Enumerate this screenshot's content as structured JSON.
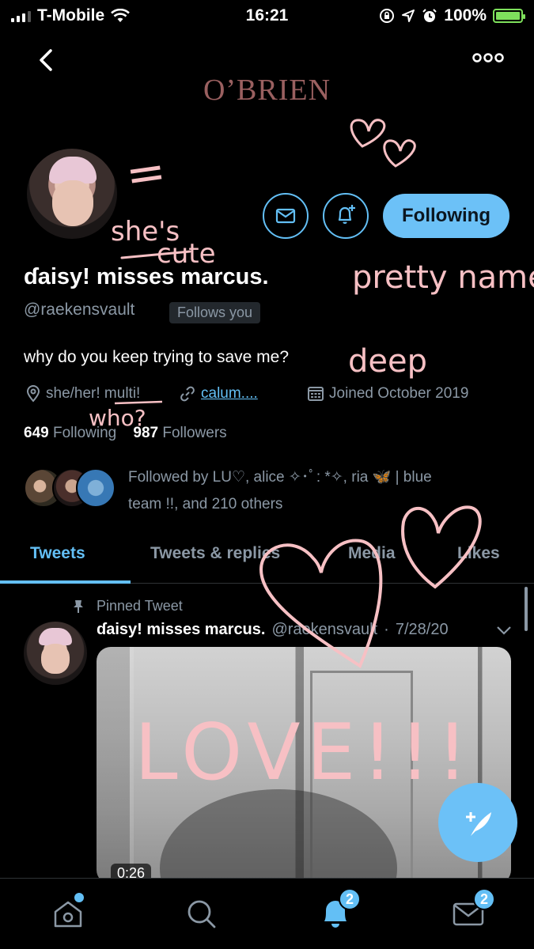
{
  "status_bar": {
    "carrier": "T-Mobile",
    "time": "16:21",
    "battery": "100%"
  },
  "header": {
    "brand": "O’BRIEN"
  },
  "profile": {
    "display_name": "ɗaisy! misses marcus.",
    "handle": "@raekensvault",
    "follows_you": "Follows you",
    "follow_button": "Following",
    "bio": "why do you keep trying to save me?",
    "location": "she/her! multi!",
    "link": "calum....",
    "joined": "Joined October 2019",
    "following_count": "649",
    "following_label": "Following",
    "followers_count": "987",
    "followers_label": "Followers",
    "followed_by_line1": "Followed by LU♡, alice ✧･ﾟ: *✧, ria 🦋 | blue",
    "followed_by_line2": "team !!, and 210 others"
  },
  "tabs": [
    {
      "label": "Tweets",
      "active": true
    },
    {
      "label": "Tweets & replies",
      "active": false
    },
    {
      "label": "Media",
      "active": false
    },
    {
      "label": "Likes",
      "active": false
    }
  ],
  "pinned_tweet": {
    "pinned_label": "Pinned Tweet",
    "author": "ɗaisy! misses marcus.",
    "handle": "@raekensvault",
    "date": "7/28/20",
    "video_duration": "0:26"
  },
  "bottom_nav": {
    "notifications_badge": "2",
    "messages_badge": "2"
  },
  "annotations": {
    "equals": "=",
    "shes": "she's",
    "cute": "cute",
    "pretty_name": "pretty name",
    "deep": "deep",
    "who": "who?",
    "love": "LOVE!!!"
  },
  "colors": {
    "accent": "#63bff5",
    "doodle": "#f7c0c4",
    "brand": "#9a6060"
  }
}
